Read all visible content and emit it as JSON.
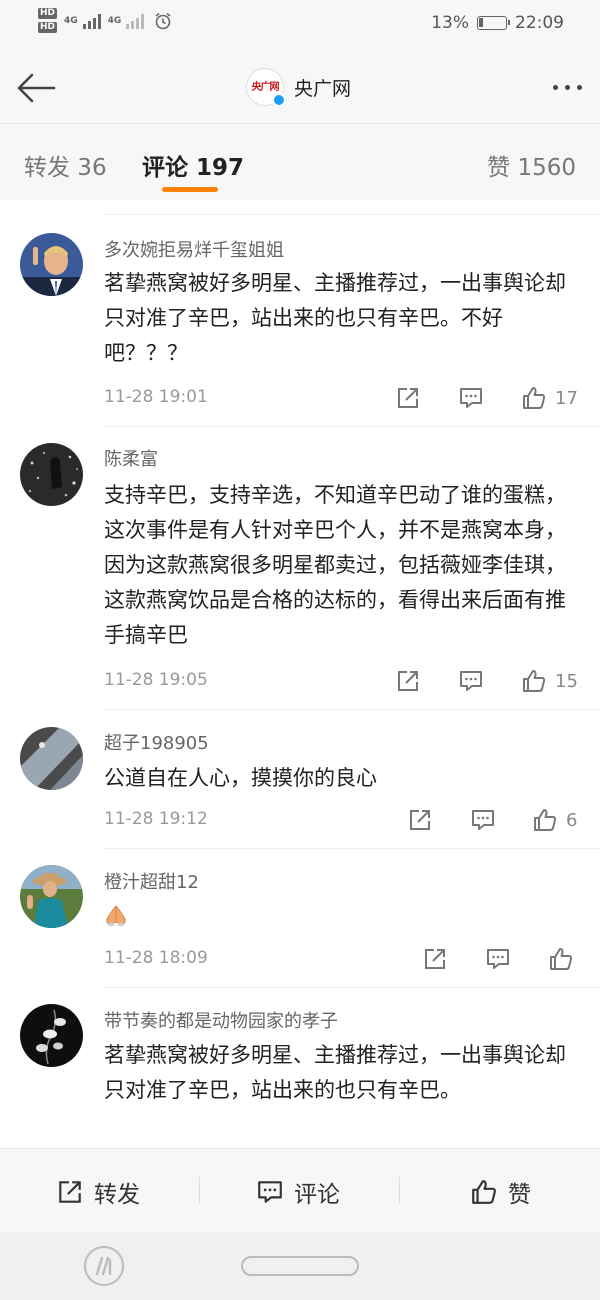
{
  "status_bar": {
    "hd1": "HD",
    "hd2": "HD",
    "net1": "4G",
    "net2": "4G",
    "battery_pct": "13%",
    "time": "22:09"
  },
  "header": {
    "logo_text": "央广网",
    "title": "央广网"
  },
  "tabs": {
    "repost": "转发 36",
    "comments": "评论 197",
    "likes": "赞 1560"
  },
  "comments": [
    {
      "username": "多次婉拒易烊千玺姐姐",
      "text": "茗挚燕窝被好多明星、主播推荐过，一出事舆论却只对准了辛巴，站出来的也只有辛巴。不好吧？？？",
      "time": "11-28 19:01",
      "likes": "17"
    },
    {
      "username": "陈柔富",
      "text": "支持辛巴，支持辛选，不知道辛巴动了谁的蛋糕，这次事件是有人针对辛巴个人，并不是燕窝本身，因为这款燕窝很多明星都卖过，包括薇娅李佳琪，这款燕窝饮品是合格的达标的，看得出来后面有推手搞辛巴",
      "time": "11-28 19:05",
      "likes": "15"
    },
    {
      "username": "超子198905",
      "text": "公道自在人心，摸摸你的良心",
      "time": "11-28 19:12",
      "likes": "6"
    },
    {
      "username": "橙汁超甜12",
      "text": "",
      "time": "11-28 18:09",
      "likes": ""
    },
    {
      "username": "带节奏的都是动物园家的孝子",
      "text": "茗挚燕窝被好多明星、主播推荐过，一出事舆论却只对准了辛巴，站出来的也只有辛巴。",
      "time": "",
      "likes": ""
    }
  ],
  "bottom_bar": {
    "repost": "转发",
    "comment": "评论",
    "like": "赞"
  },
  "icons": {
    "back": "back-arrow-icon",
    "more": "more-dots-icon",
    "share": "share-icon",
    "comment": "comment-icon",
    "like": "thumbs-up-icon",
    "emoji": "praying-hands-emoji"
  },
  "colors": {
    "accent": "#ff8200",
    "brand_red": "#c8161d",
    "verified_blue": "#1e9ff2"
  }
}
